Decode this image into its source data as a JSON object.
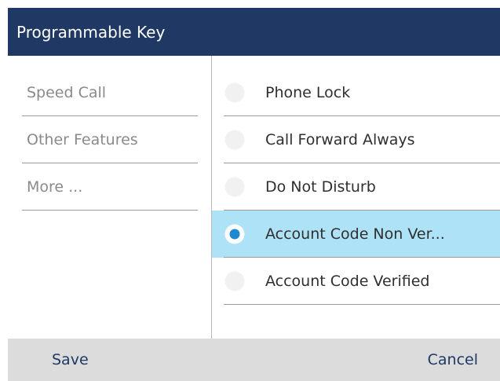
{
  "header": {
    "title": "Programmable Key"
  },
  "left_menu": {
    "items": [
      {
        "label": "Speed Call"
      },
      {
        "label": "Other Features"
      },
      {
        "label": "More ..."
      }
    ]
  },
  "options": {
    "items": [
      {
        "label": "Phone Lock",
        "selected": false
      },
      {
        "label": "Call Forward Always",
        "selected": false
      },
      {
        "label": "Do Not Disturb",
        "selected": false
      },
      {
        "label": "Account Code Non Ver...",
        "selected": true
      },
      {
        "label": "Account Code Verified",
        "selected": false
      }
    ]
  },
  "footer": {
    "save_label": "Save",
    "cancel_label": "Cancel"
  },
  "colors": {
    "header_bg": "#1f3864",
    "selected_row_bg": "#aee2f6",
    "radio_selected": "#1e88d0",
    "footer_bg": "#dcdcdc"
  },
  "icons": {
    "radio_unselected": "radio-unselected-icon",
    "radio_selected": "radio-selected-icon"
  }
}
